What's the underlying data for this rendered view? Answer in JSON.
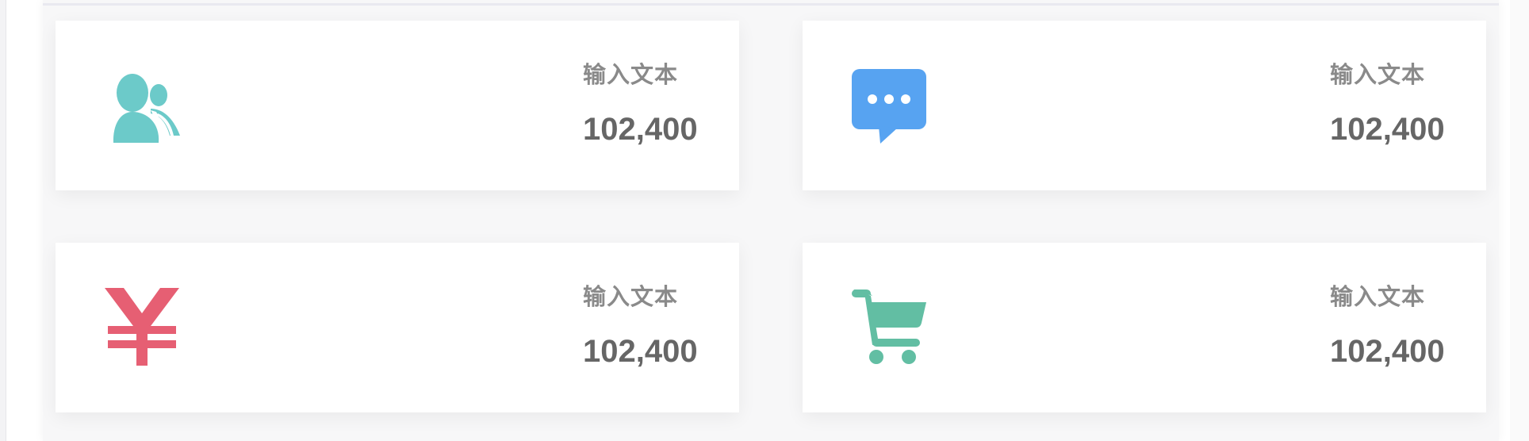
{
  "theme": {
    "users_color": "#6ccac9",
    "messages_color": "#57a3f1",
    "money_color": "#e65f73",
    "cart_color": "#62bea3"
  },
  "cards": [
    {
      "icon": "users-icon",
      "label": "输入文本",
      "value": "102,400"
    },
    {
      "icon": "message-icon",
      "label": "输入文本",
      "value": "102,400"
    },
    {
      "icon": "yen-icon",
      "label": "输入文本",
      "value": "102,400"
    },
    {
      "icon": "cart-icon",
      "label": "输入文本",
      "value": "102,400"
    }
  ]
}
